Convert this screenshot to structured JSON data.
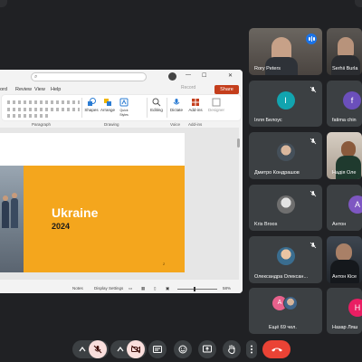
{
  "presentation": {
    "menu": [
      "ord",
      "Review",
      "View",
      "Help"
    ],
    "record_label": "Record",
    "share_label": "Share",
    "ribbon": {
      "groups": [
        "Paragraph",
        "Drawing",
        "Voice",
        "Add-ins"
      ],
      "buttons": [
        "Shapes",
        "Arrange",
        "Quick Styles",
        "Editing",
        "Dictate",
        "Add-ins",
        "Designer"
      ]
    },
    "slide": {
      "title": "Ukraine",
      "year": "2024",
      "page_number": "2"
    },
    "status": {
      "notes": "Notes",
      "display_settings": "Display Settings",
      "zoom": "58%"
    },
    "colors": {
      "slide_accent": "#f4a61d",
      "share_button": "#c43e1c"
    }
  },
  "participants": [
    {
      "name": "Rory Peters",
      "kind": "video",
      "speaking": true
    },
    {
      "name": "Serhii Burla",
      "kind": "video",
      "speaking": false
    },
    {
      "name": "Ілля Белоус",
      "kind": "avatar",
      "initial": "І",
      "color": "#12a4af",
      "muted": true
    },
    {
      "name": "fatima chin",
      "kind": "avatar",
      "initial": "f",
      "color": "#6b4fbb",
      "muted": false
    },
    {
      "name": "Дмитро Кондрашов",
      "kind": "photo",
      "muted": true
    },
    {
      "name": "Надія Оле",
      "kind": "video",
      "muted": false
    },
    {
      "name": "Kris Broos",
      "kind": "photo",
      "muted": true
    },
    {
      "name": "Антон",
      "kind": "avatar",
      "initial": "А",
      "color": "#7e57c2",
      "muted": false
    },
    {
      "name": "Олександра Олексан...",
      "kind": "photo",
      "muted": true
    },
    {
      "name": "Антон Кісе",
      "kind": "video",
      "muted": false
    },
    {
      "name": "Ещё 69 чел.",
      "kind": "more",
      "muted": false
    },
    {
      "name": "Назар Ляш",
      "kind": "avatar",
      "initial": "Н",
      "color": "#e91e63",
      "muted": false
    }
  ],
  "controls": [
    "chevron-up",
    "mic-off",
    "chevron-up",
    "camera-off",
    "captions",
    "emoji",
    "present",
    "raise-hand",
    "more",
    "leave-call"
  ],
  "colors": {
    "background": "#202124",
    "tile": "#3c4043",
    "leave": "#ea4335",
    "muted_control": "#f9dedc"
  }
}
